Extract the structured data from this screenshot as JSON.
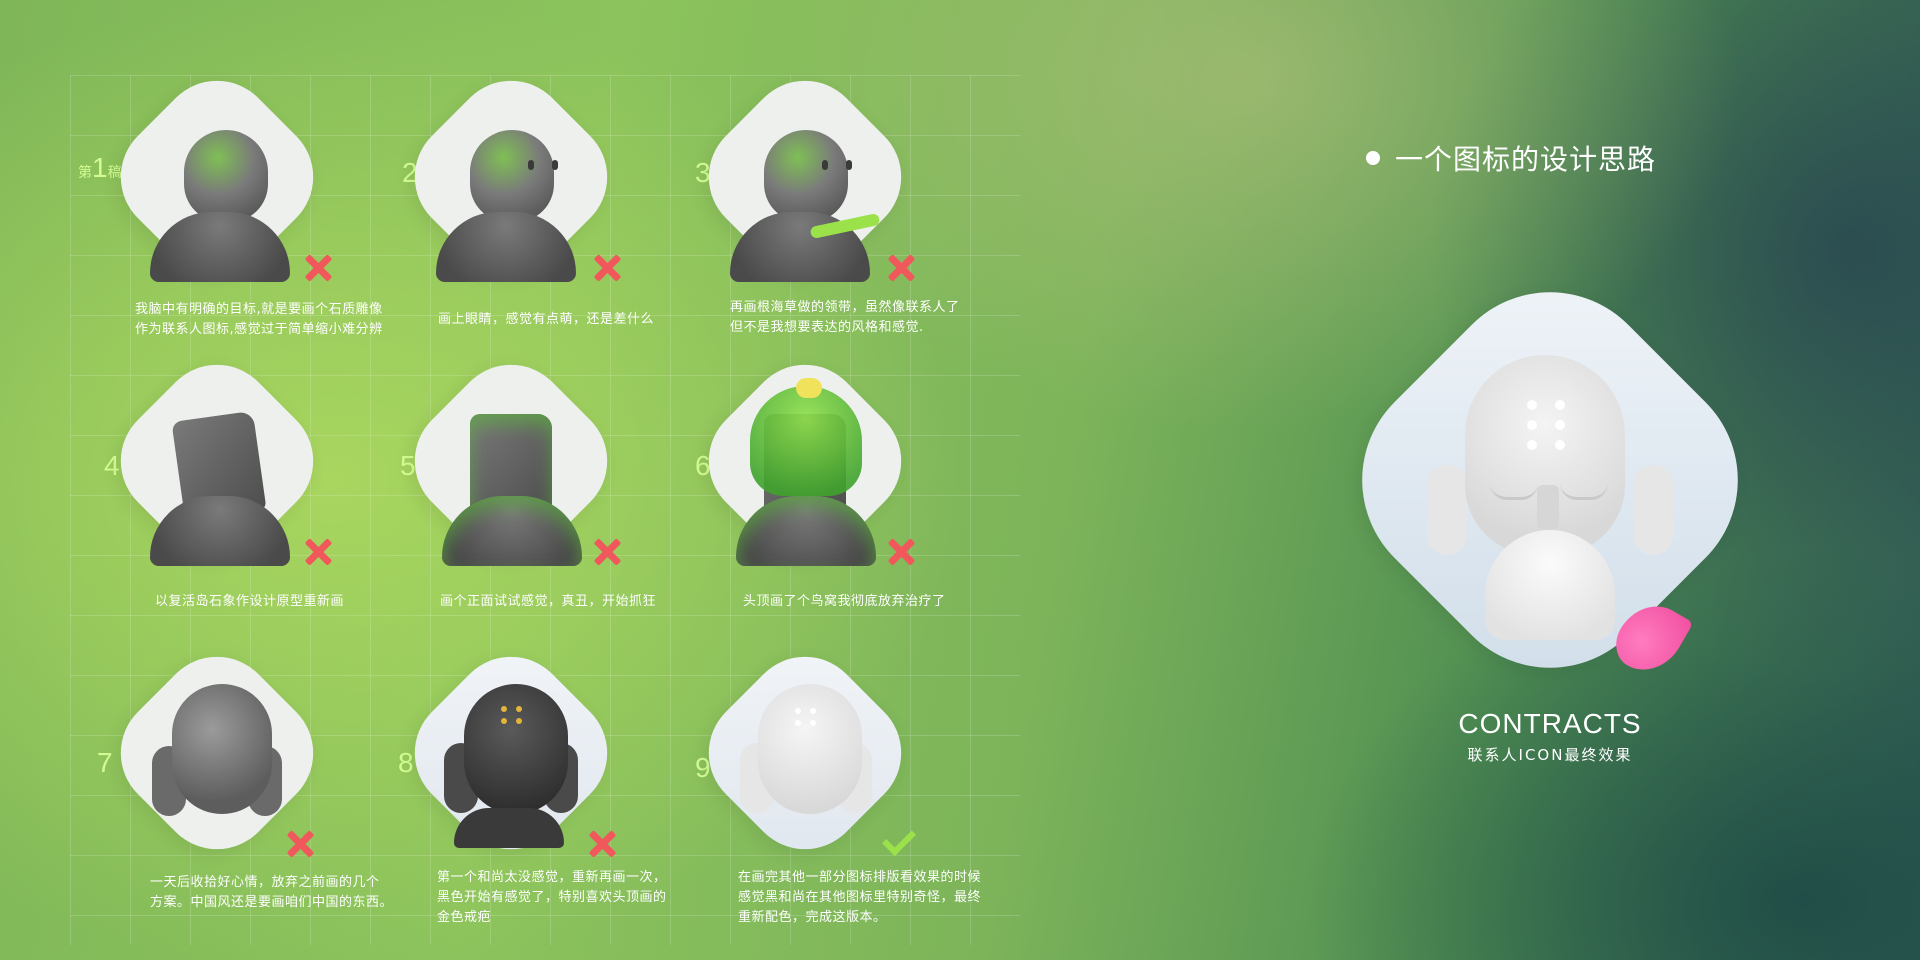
{
  "section_title": "一个图标的设计思路",
  "final": {
    "brand": "CONTRACTS",
    "subtitle": "联系人ICON最终效果"
  },
  "steps": [
    {
      "prefix": "第",
      "number": "1",
      "suffix": "稿",
      "caption": "我脑中有明确的目标,就是要画个石质雕像\n作为联系人图标,感觉过于简单缩小难分辨",
      "status": "rejected"
    },
    {
      "prefix": "",
      "number": "2",
      "suffix": "",
      "caption": "画上眼睛，感觉有点萌，还是差什么",
      "status": "rejected"
    },
    {
      "prefix": "",
      "number": "3",
      "suffix": "",
      "caption": "再画根海草做的领带，虽然像联系人了\n但不是我想要表达的风格和感觉.",
      "status": "rejected"
    },
    {
      "prefix": "",
      "number": "4",
      "suffix": "",
      "caption": "以复活岛石象作设计原型重新画",
      "status": "rejected"
    },
    {
      "prefix": "",
      "number": "5",
      "suffix": "",
      "caption": "画个正面试试感觉，真丑，开始抓狂",
      "status": "rejected"
    },
    {
      "prefix": "",
      "number": "6",
      "suffix": "",
      "caption": "头顶画了个鸟窝我彻底放弃治疗了",
      "status": "rejected"
    },
    {
      "prefix": "",
      "number": "7",
      "suffix": "",
      "caption": "一天后收拾好心情，放弃之前画的几个\n方案。中国风还是要画咱们中国的东西。",
      "status": "rejected"
    },
    {
      "prefix": "",
      "number": "8",
      "suffix": "",
      "caption": "第一个和尚太没感觉，重新再画一次，\n黑色开始有感觉了，特别喜欢头顶画的\n金色戒疤",
      "status": "rejected"
    },
    {
      "prefix": "",
      "number": "9",
      "suffix": "",
      "caption": "在画完其他一部分图标排版看效果的时候\n感觉黑和尚在其他图标里特别奇怪，最终\n重新配色，完成这版本。",
      "status": "approved"
    }
  ]
}
